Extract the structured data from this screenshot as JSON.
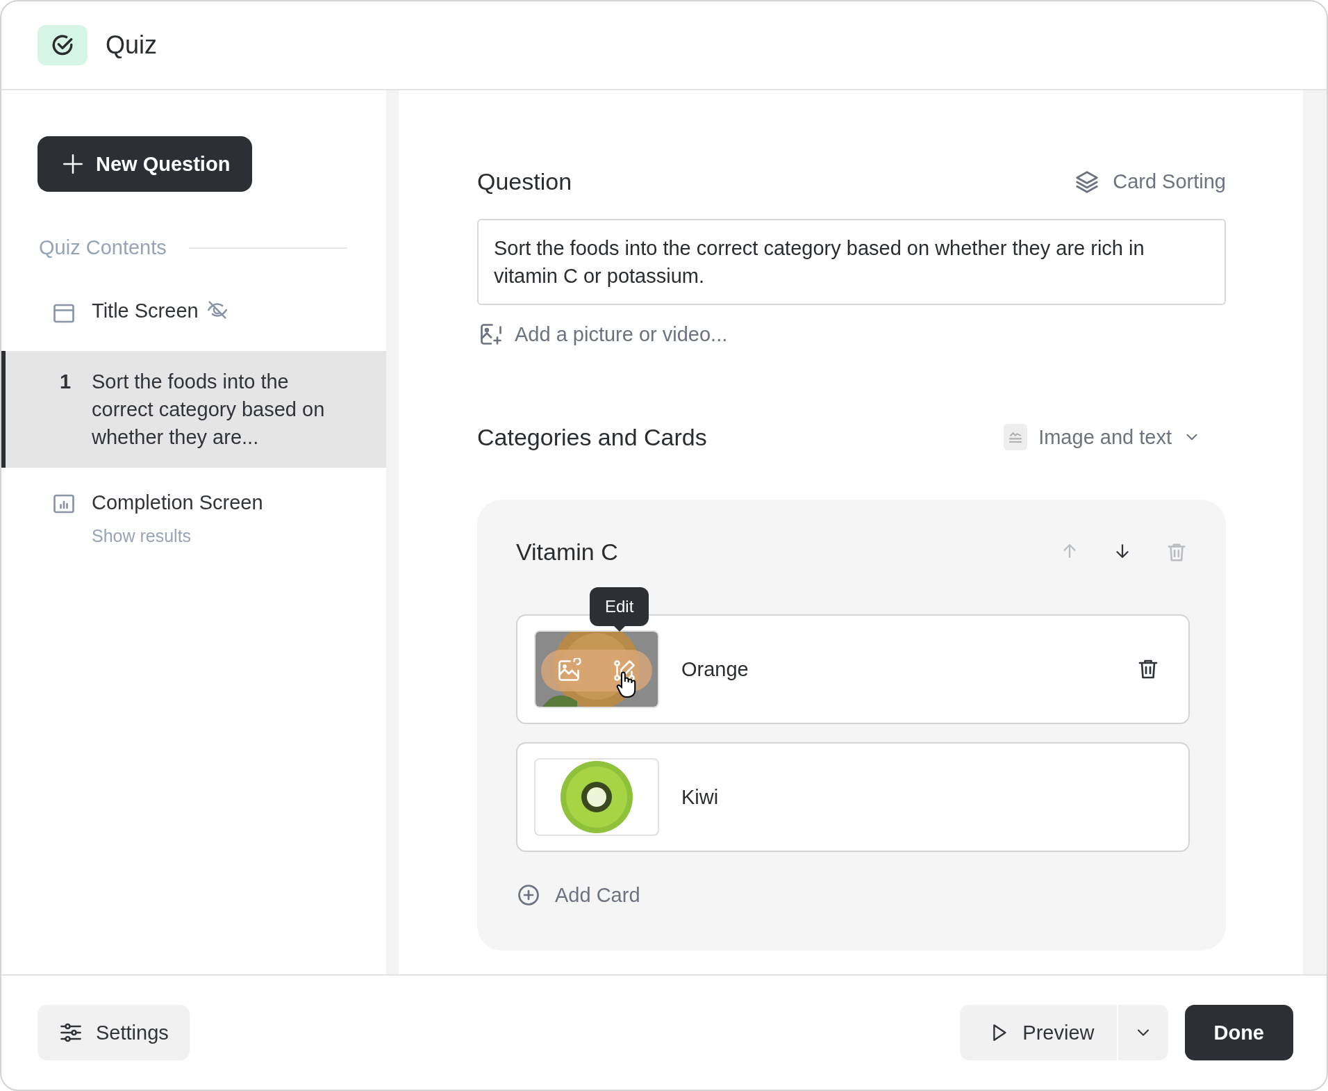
{
  "header": {
    "title": "Quiz"
  },
  "sidebar": {
    "new_button": "New Question",
    "section_title": "Quiz Contents",
    "items": [
      {
        "kind": "title",
        "label": "Title Screen",
        "hidden": true,
        "selected": false
      },
      {
        "kind": "question",
        "number": "1",
        "label": "Sort the foods into the correct category based on whether they are...",
        "selected": true
      },
      {
        "kind": "completion",
        "label": "Completion Screen",
        "subtitle": "Show results",
        "selected": false
      }
    ]
  },
  "question": {
    "heading": "Question",
    "type": "Card Sorting",
    "text": "Sort the foods into the correct category based on whether they are rich in vitamin C or potassium.",
    "add_media": "Add a picture or video..."
  },
  "categories": {
    "heading": "Categories and Cards",
    "display_mode": "Image and text",
    "groups": [
      {
        "name": "Vitamin C",
        "actions": [
          {
            "kind": "up",
            "disabled": true
          },
          {
            "kind": "down",
            "disabled": false
          },
          {
            "kind": "delete",
            "disabled": true
          }
        ],
        "cards": [
          {
            "kind": "orange",
            "label": "Orange",
            "hovered": true,
            "tooltip": "Edit"
          },
          {
            "kind": "kiwi",
            "label": "Kiwi",
            "hovered": false
          }
        ],
        "add_card": "Add Card"
      }
    ]
  },
  "footer": {
    "settings": "Settings",
    "preview": "Preview",
    "done": "Done"
  }
}
